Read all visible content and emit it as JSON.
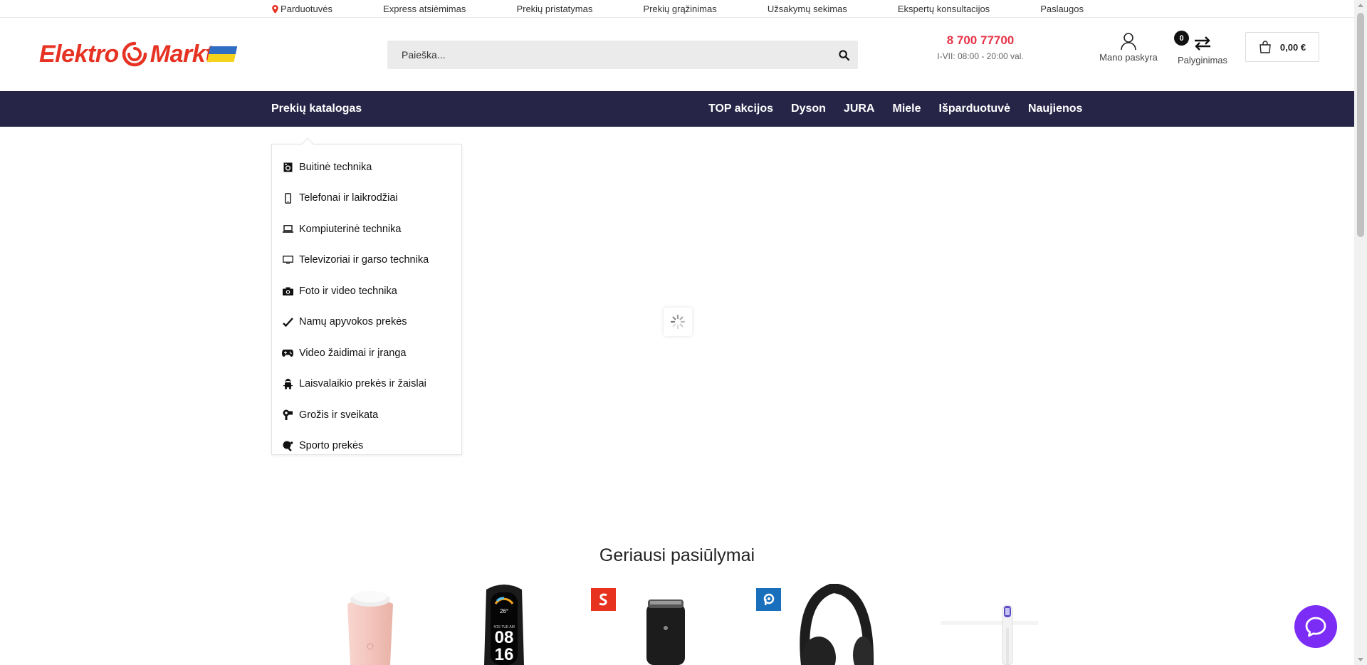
{
  "topbar": {
    "links": [
      {
        "label": "Parduotuvės",
        "icon": "map-pin-icon"
      },
      {
        "label": "Express atsiėmimas"
      },
      {
        "label": "Prekių pristatymas"
      },
      {
        "label": "Prekių grąžinimas"
      },
      {
        "label": "Užsakymų sekimas"
      },
      {
        "label": "Ekspertų konsultacijos"
      },
      {
        "label": "Paslaugos"
      }
    ]
  },
  "header": {
    "logo_text_left": "Elektro",
    "logo_text_right": "Markt",
    "search_placeholder": "Paieška...",
    "phone": "8 700 77700",
    "hours": "I-VII: 08:00 - 20:00 val.",
    "account_label": "Mano paskyra",
    "compare_label": "Palyginimas",
    "compare_count": "0",
    "cart_total": "0,00 €"
  },
  "nav": {
    "catalog_label": "Prekių katalogas",
    "links": [
      "TOP akcijos",
      "Dyson",
      "JURA",
      "Miele",
      "Išparduotuvė",
      "Naujienos"
    ]
  },
  "catalog_menu": [
    {
      "label": "Buitinė technika",
      "icon": "washing-machine-icon"
    },
    {
      "label": "Telefonai ir laikrodžiai",
      "icon": "phone-icon"
    },
    {
      "label": "Kompiuterinė technika",
      "icon": "laptop-icon"
    },
    {
      "label": "Televizoriai ir garso technika",
      "icon": "tv-icon"
    },
    {
      "label": "Foto ir video technika",
      "icon": "camera-icon"
    },
    {
      "label": "Namų apyvokos prekės",
      "icon": "household-icon"
    },
    {
      "label": "Video žaidimai ir įranga",
      "icon": "gamepad-icon"
    },
    {
      "label": "Laisvalaikio prekės ir žaislai",
      "icon": "toy-icon"
    },
    {
      "label": "Grožis ir sveikata",
      "icon": "hairdryer-icon"
    },
    {
      "label": "Sporto prekės",
      "icon": "ping-pong-icon"
    }
  ],
  "best_offers": {
    "title": "Geriausi pasiūlymai",
    "watch_temp": "26°",
    "watch_day": "4/15 TUE AM",
    "watch_hour": "08",
    "watch_min": "16"
  },
  "colors": {
    "brand_red": "#e63323",
    "nav_bg": "#262548",
    "phone_red": "#e63347",
    "chat_purple": "#7b2cf5",
    "search_bg": "#ebebeb"
  }
}
